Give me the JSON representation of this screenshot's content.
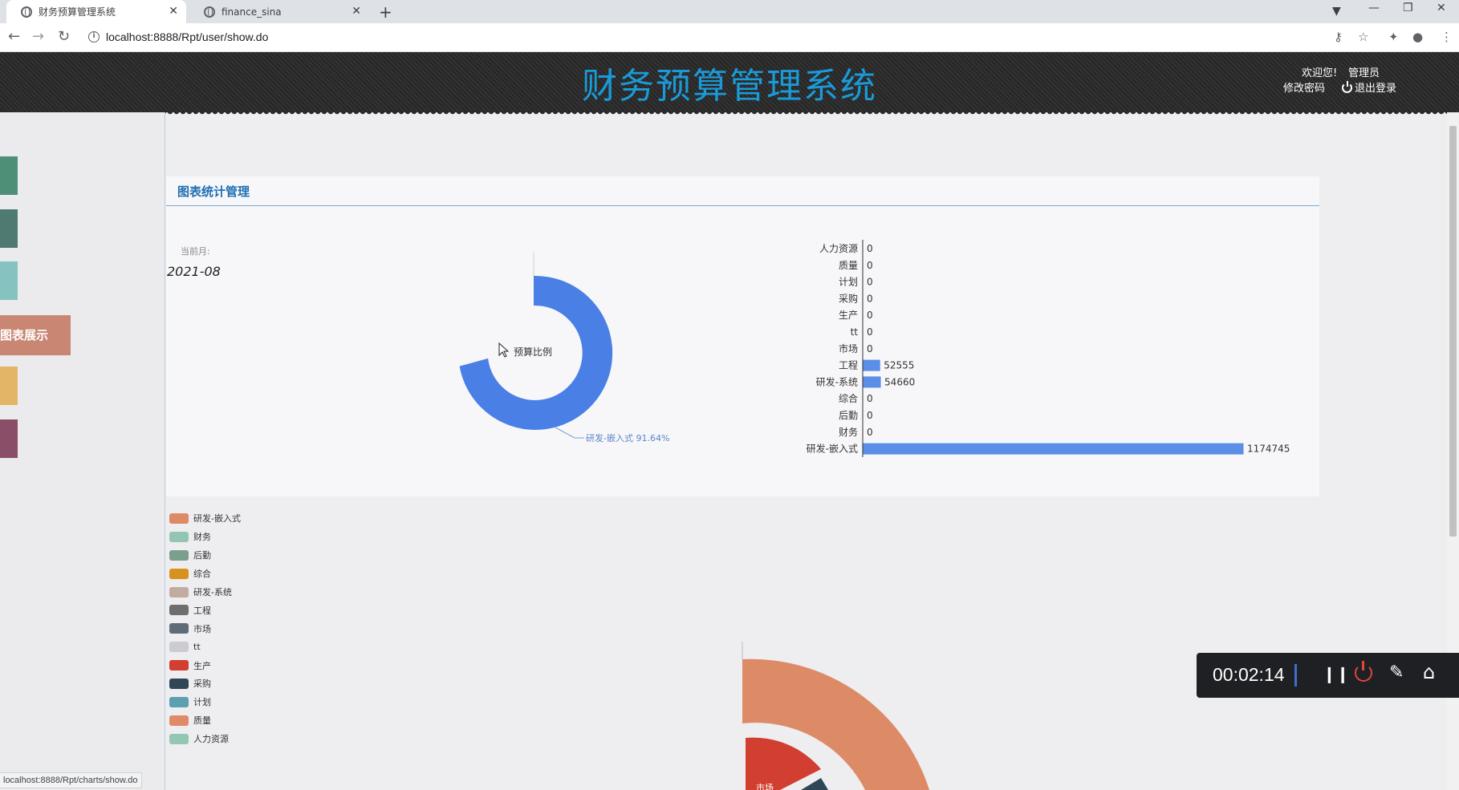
{
  "browser": {
    "tabs": [
      {
        "title": "财务预算管理系统",
        "active": true
      },
      {
        "title": "finance_sina",
        "active": false
      }
    ],
    "url": "localhost:8888/Rpt/user/show.do",
    "status_url": "localhost:8888/Rpt/charts/show.do"
  },
  "header": {
    "title": "财务预算管理系统",
    "welcome": "欢迎您!",
    "user": "管理员",
    "change_password": "修改密码",
    "logout": "退出登录"
  },
  "sidebar": {
    "active_item": "图表展示",
    "tab_colors": [
      "#4e8f78",
      "#4f7a72",
      "#86c3c0",
      "#c98673",
      "#e3b566",
      "#8a4e68"
    ]
  },
  "panel": {
    "title": "图表统计管理",
    "current_month_label": "当前月:",
    "current_month": "2021-08"
  },
  "donut": {
    "center_label": "预算比例",
    "slice_label": "研发-嵌入式 91.64%"
  },
  "chart_data": {
    "type": "bar",
    "orientation": "horizontal",
    "categories": [
      "人力资源",
      "质量",
      "计划",
      "采购",
      "生产",
      "tt",
      "市场",
      "工程",
      "研发-系统",
      "综合",
      "后勤",
      "财务",
      "研发-嵌入式"
    ],
    "values": [
      0,
      0,
      0,
      0,
      0,
      0,
      0,
      52555,
      54660,
      0,
      0,
      0,
      1174745
    ],
    "color": "#5b8ee6"
  },
  "legend": [
    {
      "label": "研发-嵌入式",
      "color": "#dd8b66"
    },
    {
      "label": "财务",
      "color": "#93c6b2"
    },
    {
      "label": "后勤",
      "color": "#7a9f8c"
    },
    {
      "label": "综合",
      "color": "#d7921d"
    },
    {
      "label": "研发-系统",
      "color": "#c2aba0"
    },
    {
      "label": "工程",
      "color": "#6e6e6e"
    },
    {
      "label": "市场",
      "color": "#5e6b78"
    },
    {
      "label": "tt",
      "color": "#cbcbd2"
    },
    {
      "label": "生产",
      "color": "#d23e2f"
    },
    {
      "label": "采购",
      "color": "#2f4657"
    },
    {
      "label": "计划",
      "color": "#5aa0b0"
    },
    {
      "label": "质量",
      "color": "#e08a6a"
    },
    {
      "label": "人力资源",
      "color": "#94c7b3"
    }
  ],
  "bottom_chart": {
    "partial_label": "市场"
  },
  "recorder": {
    "time": "00:02:14"
  }
}
